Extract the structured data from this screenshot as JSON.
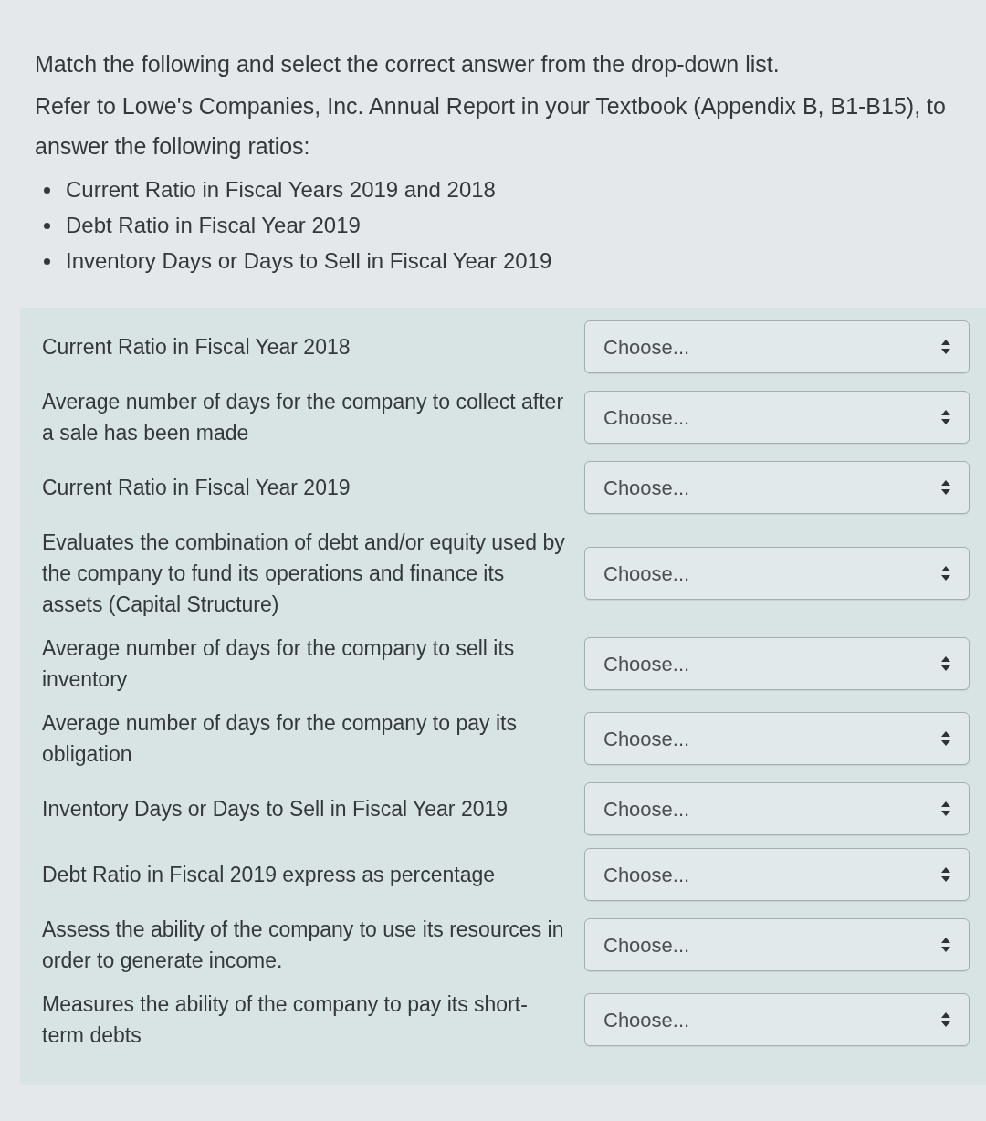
{
  "instruction": "Match the following and select the correct answer from the drop-down list.",
  "reference": "Refer to Lowe's Companies, Inc. Annual Report in your Textbook (Appendix B, B1-B15), to answer the following ratios:",
  "ratios": [
    "Current Ratio in Fiscal Years 2019 and 2018",
    "Debt Ratio in Fiscal Year 2019",
    "Inventory Days or Days to Sell in Fiscal Year 2019"
  ],
  "matches": [
    {
      "prompt": "Current Ratio in Fiscal Year 2018",
      "select": {
        "value": "Choose..."
      }
    },
    {
      "prompt": "Average number of days for the company to collect after a sale has been made",
      "select": {
        "value": "Choose..."
      }
    },
    {
      "prompt": "Current Ratio in Fiscal Year 2019",
      "select": {
        "value": "Choose..."
      }
    },
    {
      "prompt": "Evaluates the combination of debt and/or equity used by the company to fund its operations and finance its assets (Capital Structure)",
      "select": {
        "value": "Choose..."
      }
    },
    {
      "prompt": "Average number of days for the company to sell its inventory",
      "select": {
        "value": "Choose..."
      }
    },
    {
      "prompt": "Average number of days for the company to pay its obligation",
      "select": {
        "value": "Choose..."
      }
    },
    {
      "prompt": "Inventory Days or Days to Sell in Fiscal Year 2019",
      "select": {
        "value": "Choose..."
      }
    },
    {
      "prompt": "Debt Ratio in Fiscal 2019 express as percentage",
      "select": {
        "value": "Choose..."
      }
    },
    {
      "prompt": "Assess the ability of the company to use its resources in order to generate income.",
      "select": {
        "value": "Choose..."
      }
    },
    {
      "prompt": "Measures the ability of the company to pay its short-term debts",
      "select": {
        "value": "Choose..."
      }
    }
  ]
}
